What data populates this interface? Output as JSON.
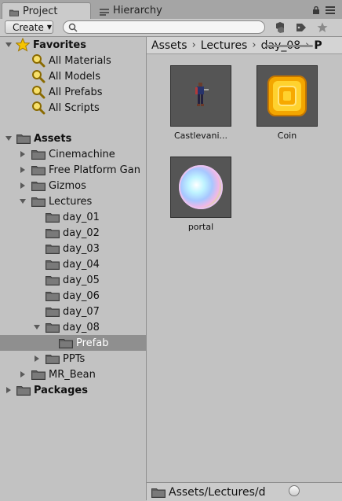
{
  "tabs": [
    {
      "label": "Project",
      "icon": "folder-icon",
      "active": true
    },
    {
      "label": "Hierarchy",
      "icon": "list-icon",
      "active": false
    }
  ],
  "toolbar": {
    "create_label": "Create",
    "search_placeholder": ""
  },
  "tree": {
    "favorites_label": "Favorites",
    "favorites": [
      "All Materials",
      "All Models",
      "All Prefabs",
      "All Scripts"
    ],
    "assets_label": "Assets",
    "assets_children": [
      "Cinemachine",
      "Free Platform Gan",
      "Gizmos",
      "Lectures"
    ],
    "lectures_children": [
      "day_01",
      "day_02",
      "day_03",
      "day_04",
      "day_05",
      "day_06",
      "day_07",
      "day_08"
    ],
    "day08_children": [
      "Prefab"
    ],
    "after_day08": [
      "PPTs"
    ],
    "after_lectures": [
      "MR_Bean"
    ],
    "packages_label": "Packages"
  },
  "breadcrumb": [
    "Assets",
    "Lectures",
    "day_08",
    "P"
  ],
  "assets_grid": [
    {
      "label": "Castlevani..."
    },
    {
      "label": "Coin"
    },
    {
      "label": "portal"
    }
  ],
  "status_path": "Assets/Lectures/d",
  "zoom_slider_fraction": 0.6,
  "colors": {
    "panel": "#c2c2c2",
    "selection": "#8f8f8f",
    "thumb_bg": "#555555",
    "star": "#f5c400"
  }
}
